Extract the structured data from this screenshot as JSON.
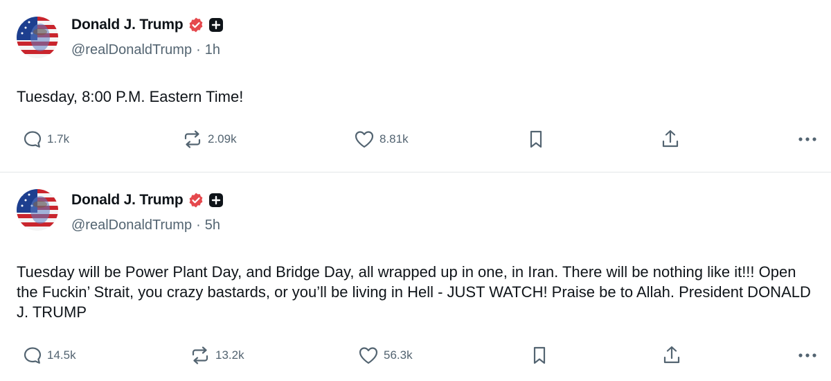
{
  "posts": [
    {
      "display_name": "Donald J. Trump",
      "handle": "@realDonaldTrump",
      "separator": "·",
      "time": "1h",
      "text": "Tuesday, 8:00 P.M. Eastern Time!",
      "replies": "1.7k",
      "reposts": "2.09k",
      "likes": "8.81k"
    },
    {
      "display_name": "Donald J. Trump",
      "handle": "@realDonaldTrump",
      "separator": "·",
      "time": "5h",
      "text": "Tuesday will be Power Plant Day, and Bridge Day, all wrapped up in one, in Iran. There will be nothing like it!!! Open the Fuckin’ Strait, you crazy bastards, or you’ll be living in Hell - JUST WATCH! Praise be to Allah. President DONALD J. TRUMP",
      "replies": "14.5k",
      "reposts": "13.2k",
      "likes": "56.3k"
    }
  ],
  "icons": {
    "verified": "verified-badge-icon",
    "plus": "plus-badge-icon",
    "reply": "speech-bubble-icon",
    "repost": "repost-arrows-icon",
    "like": "heart-icon",
    "bookmark": "bookmark-icon",
    "share": "share-upload-icon",
    "more": "more-dots-icon"
  },
  "colors": {
    "verified_badge": "#e5484d",
    "text_primary": "#0f1419",
    "text_secondary": "#536471",
    "divider": "#e3e6e8"
  }
}
